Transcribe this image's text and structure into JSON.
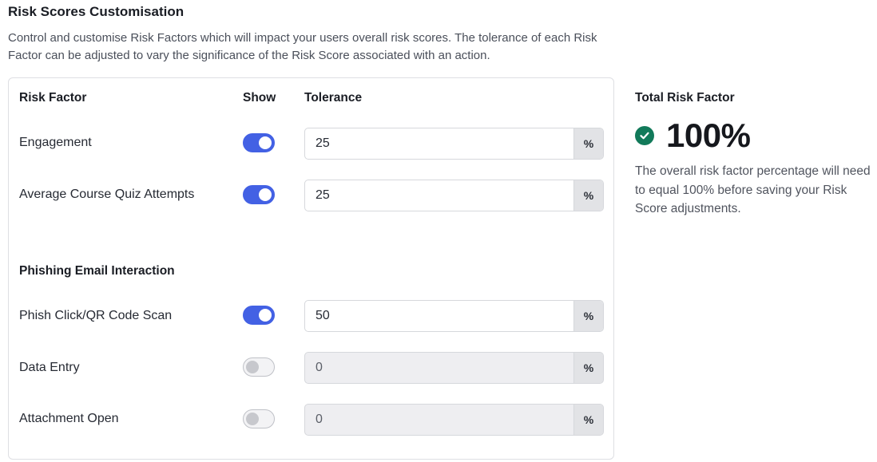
{
  "header": {
    "title": "Risk Scores Customisation",
    "description": "Control and customise Risk Factors which will impact your users overall risk scores. The tolerance of each Risk Factor can be adjusted to vary the significance of the Risk Score associated with an action."
  },
  "table": {
    "col_risk_factor": "Risk Factor",
    "col_show": "Show",
    "col_tolerance": "Tolerance",
    "suffix_icon": "percent-icon",
    "rows": [
      {
        "label": "Engagement",
        "show": true,
        "value": "25"
      },
      {
        "label": "Average Course Quiz Attempts",
        "show": true,
        "value": "25"
      }
    ],
    "section_phishing": "Phishing Email Interaction",
    "phishing_rows": [
      {
        "label": "Phish Click/QR Code Scan",
        "show": true,
        "value": "50"
      },
      {
        "label": "Data Entry",
        "show": false,
        "value": "0"
      },
      {
        "label": "Attachment Open",
        "show": false,
        "value": "0"
      }
    ]
  },
  "total": {
    "heading": "Total Risk Factor",
    "value": "100%",
    "status_icon": "check-circle-icon",
    "status_color": "#127a5a",
    "note": "The overall risk factor percentage will need to equal 100% before saving your Risk Score adjustments."
  },
  "colors": {
    "toggle_on": "#4361e4",
    "toggle_off": "#c7c8cd"
  }
}
